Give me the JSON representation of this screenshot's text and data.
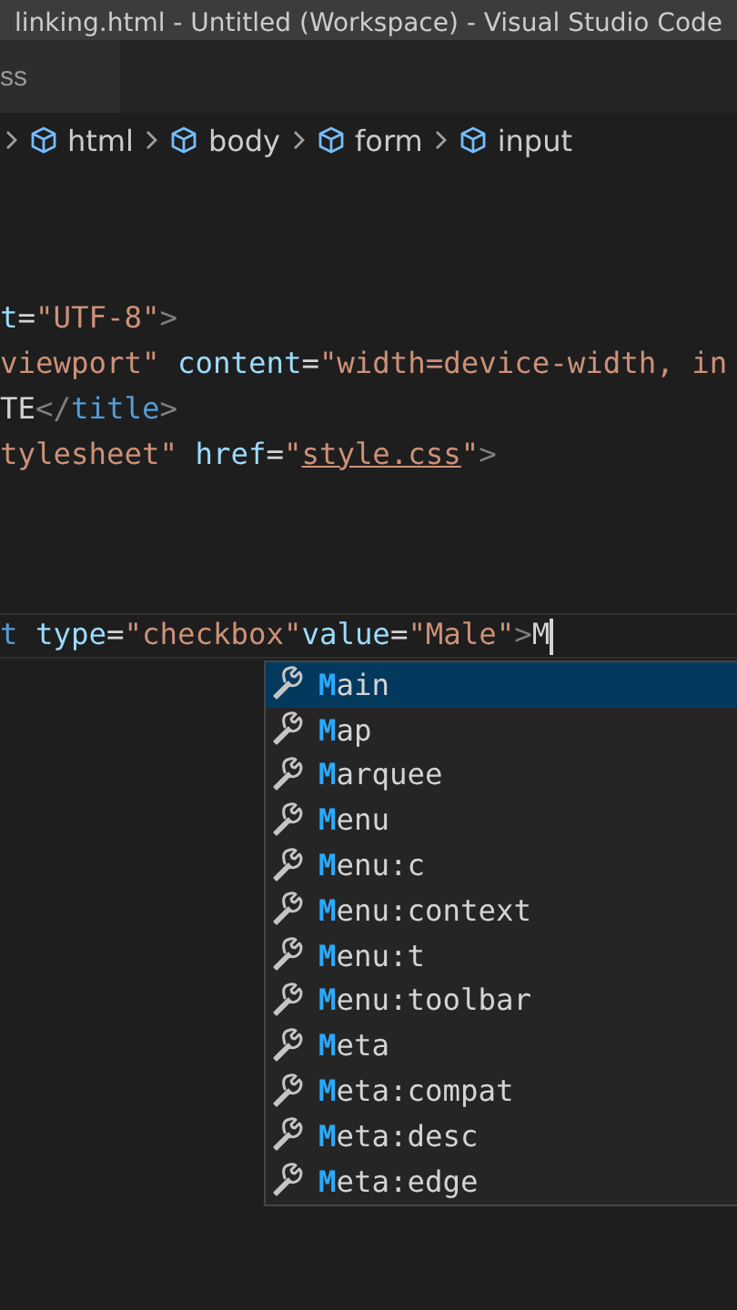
{
  "window": {
    "title": "linking.html - Untitled (Workspace) - Visual Studio Code"
  },
  "tabs": [
    {
      "label": "ss",
      "selected": true
    }
  ],
  "breadcrumbs": [
    {
      "label": "html"
    },
    {
      "label": "body"
    },
    {
      "label": "form"
    },
    {
      "label": "input"
    }
  ],
  "code_groups": [
    {
      "lines": [
        {
          "tokens": [
            {
              "kind": "attr",
              "text": "t"
            },
            {
              "kind": "text",
              "text": "="
            },
            {
              "kind": "string",
              "text": "\"UTF-8\""
            },
            {
              "kind": "punct",
              "text": ">"
            }
          ]
        },
        {
          "tokens": [
            {
              "kind": "string",
              "text": "viewport\""
            },
            {
              "kind": "attr",
              "text": " content"
            },
            {
              "kind": "text",
              "text": "="
            },
            {
              "kind": "string",
              "text": "\"width=device-width, in"
            }
          ]
        },
        {
          "tokens": [
            {
              "kind": "text",
              "text": "TE"
            },
            {
              "kind": "punct",
              "text": "</"
            },
            {
              "kind": "tag",
              "text": "title"
            },
            {
              "kind": "punct",
              "text": ">"
            }
          ]
        },
        {
          "tokens": [
            {
              "kind": "string",
              "text": "tylesheet\""
            },
            {
              "kind": "attr",
              "text": " href"
            },
            {
              "kind": "text",
              "text": "="
            },
            {
              "kind": "string",
              "text": "\""
            },
            {
              "kind": "link",
              "text": "style.css"
            },
            {
              "kind": "string",
              "text": "\""
            },
            {
              "kind": "punct",
              "text": ">"
            }
          ]
        }
      ]
    },
    {
      "lines": [
        {
          "current": true,
          "tokens": [
            {
              "kind": "tag",
              "text": "t"
            },
            {
              "kind": "attr",
              "text": " type"
            },
            {
              "kind": "text",
              "text": "="
            },
            {
              "kind": "string",
              "text": "\"checkbox\""
            },
            {
              "kind": "attr",
              "text": "value"
            },
            {
              "kind": "text",
              "text": "="
            },
            {
              "kind": "string",
              "text": "\"Male\""
            },
            {
              "kind": "punct",
              "text": ">"
            },
            {
              "kind": "text",
              "text": "M"
            }
          ]
        }
      ]
    }
  ],
  "suggestions": [
    {
      "match": "M",
      "rest": "ain",
      "selected": true
    },
    {
      "match": "M",
      "rest": "ap",
      "selected": false
    },
    {
      "match": "M",
      "rest": "arquee",
      "selected": false
    },
    {
      "match": "M",
      "rest": "enu",
      "selected": false
    },
    {
      "match": "M",
      "rest": "enu:c",
      "selected": false
    },
    {
      "match": "M",
      "rest": "enu:context",
      "selected": false
    },
    {
      "match": "M",
      "rest": "enu:t",
      "selected": false
    },
    {
      "match": "M",
      "rest": "enu:toolbar",
      "selected": false
    },
    {
      "match": "M",
      "rest": "eta",
      "selected": false
    },
    {
      "match": "M",
      "rest": "eta:compat",
      "selected": false
    },
    {
      "match": "M",
      "rest": "eta:desc",
      "selected": false
    },
    {
      "match": "M",
      "rest": "eta:edge",
      "selected": false
    }
  ]
}
